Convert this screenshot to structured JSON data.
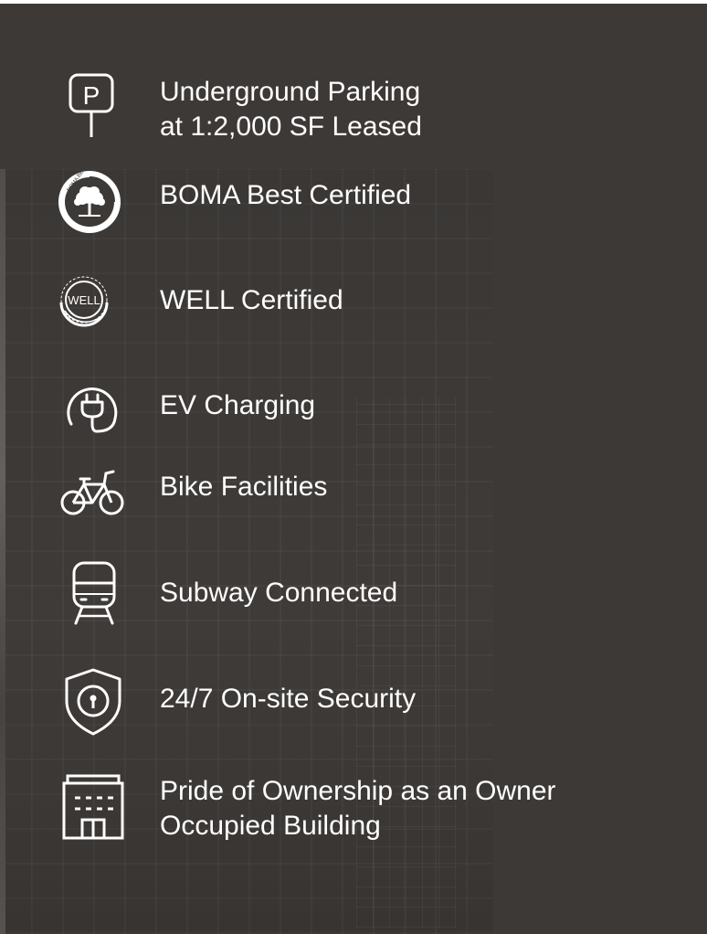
{
  "amenities": [
    {
      "icon": "parking-icon",
      "lines": [
        "Underground Parking",
        "at 1:2,000 SF Leased"
      ]
    },
    {
      "icon": "boma-best-logo",
      "lines": [
        "BOMA Best Certified"
      ],
      "logo_text": "BOMA BEST"
    },
    {
      "icon": "well-logo",
      "lines": [
        "WELL Certified"
      ],
      "logo_text": "WELL"
    },
    {
      "icon": "ev-charging-icon",
      "lines": [
        "EV Charging"
      ]
    },
    {
      "icon": "bike-icon",
      "lines": [
        "Bike Facilities"
      ]
    },
    {
      "icon": "subway-icon",
      "lines": [
        "Subway Connected"
      ]
    },
    {
      "icon": "security-shield-icon",
      "lines": [
        "24/7 On-site Security"
      ]
    },
    {
      "icon": "building-icon",
      "lines": [
        "Pride of Ownership as an Owner",
        "Occupied Building"
      ]
    }
  ],
  "colors": {
    "background": "#3d3937",
    "text": "#ffffff"
  }
}
